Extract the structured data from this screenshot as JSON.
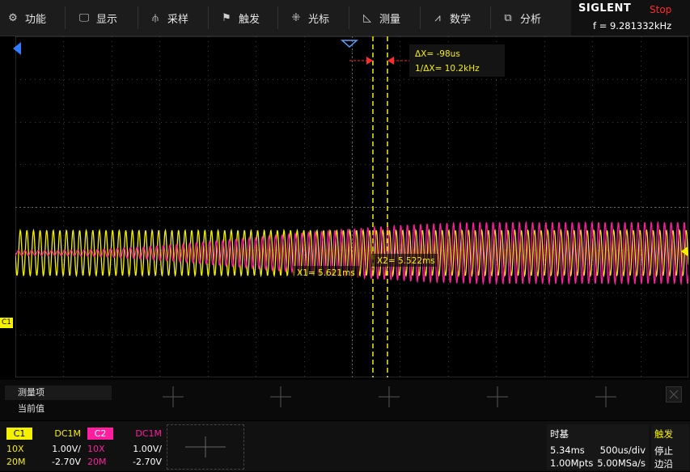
{
  "menu": [
    {
      "icon": "⚙",
      "icon_name": "gear-icon",
      "label": "功能"
    },
    {
      "icon": "🖵",
      "icon_name": "monitor-icon",
      "label": "显示"
    },
    {
      "icon": "⫛",
      "icon_name": "sampling-icon",
      "label": "采样"
    },
    {
      "icon": "⚑",
      "icon_name": "flag-icon",
      "label": "触发"
    },
    {
      "icon": "⁜",
      "icon_name": "cursor-icon",
      "label": "光标"
    },
    {
      "icon": "◺",
      "icon_name": "measure-icon",
      "label": "测量"
    },
    {
      "icon": "⩘",
      "icon_name": "math-icon",
      "label": "数学"
    },
    {
      "icon": "⧉",
      "icon_name": "analysis-icon",
      "label": "分析"
    }
  ],
  "brand": {
    "logo": "SIGLENT",
    "state": "Stop",
    "frequency": "f = 9.281332kHz"
  },
  "cursors": {
    "delta_x": "ΔX= -98us",
    "inv_delta_x": "1/ΔX= 10.2kHz",
    "x1_label": "X1= 5.621ms",
    "x2_label": "X2= 5.522ms"
  },
  "channel_marker": "C1",
  "measure": {
    "item_label": "测量项",
    "value_label": "当前值"
  },
  "ch1": {
    "name": "C1",
    "coupling": "DC1M",
    "probe": "10X",
    "scale": "1.00V/",
    "bw": "20M",
    "offset": "-2.70V"
  },
  "ch2": {
    "name": "C2",
    "coupling": "DC1M",
    "probe": "10X",
    "scale": "1.00V/",
    "bw": "20M",
    "offset": "-2.70V"
  },
  "timebase": {
    "title": "时基",
    "delay": "5.34ms",
    "scale": "500us/div",
    "memory": "1.00Mpts",
    "sample_rate": "5.00MSa/s"
  },
  "trigger": {
    "title": "触发",
    "status": "停止",
    "type": "边沿"
  },
  "colors": {
    "ch1": "#f5f000",
    "ch2": "#ff1e9e",
    "cursor": "#f5f000",
    "stop": "#ff2a2a"
  }
}
